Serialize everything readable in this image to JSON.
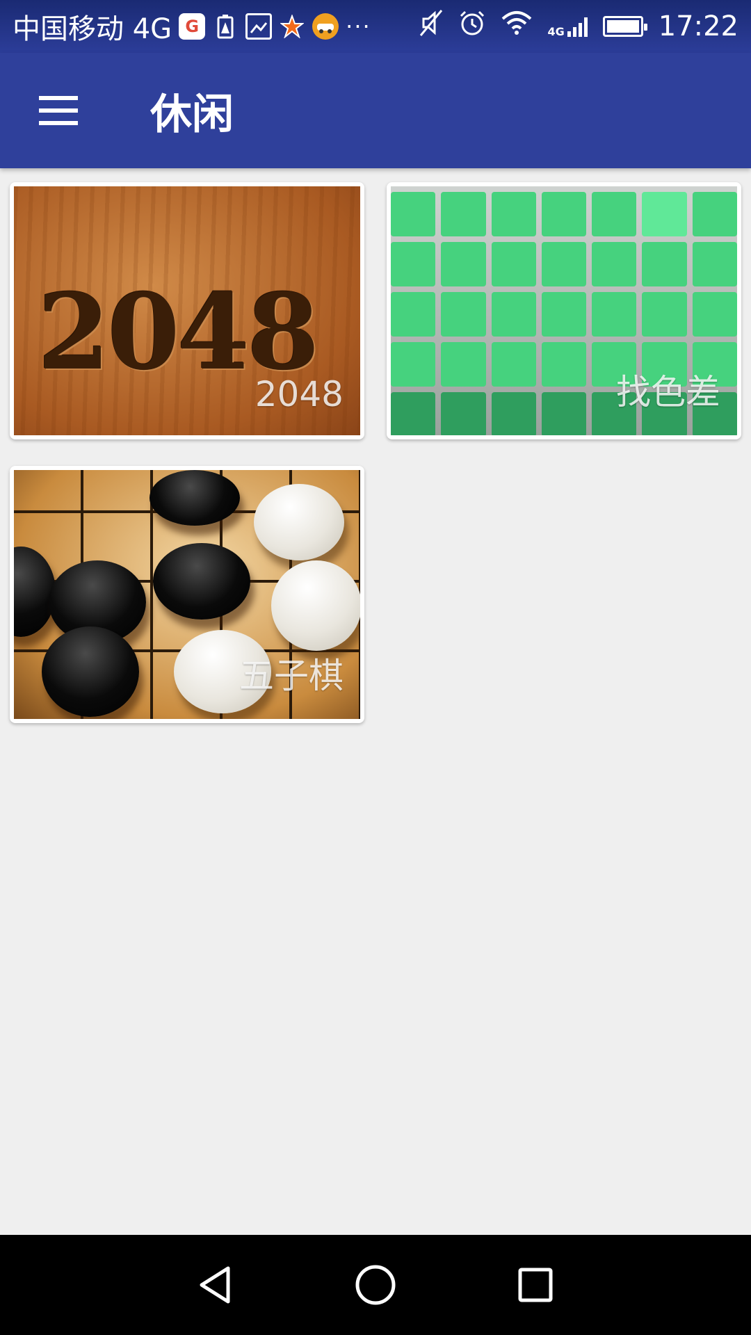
{
  "status_bar": {
    "carrier": "中国移动 4G",
    "network": "4G",
    "time": "17:22",
    "icons": [
      "google-icon",
      "battery-alert-icon",
      "image-icon",
      "star-badge-icon",
      "car-app-icon",
      "more-dots-icon",
      "mute-icon",
      "alarm-icon",
      "wifi-icon",
      "signal-icon",
      "battery-icon"
    ]
  },
  "app_bar": {
    "title": "休闲",
    "menu_icon": "hamburger-icon"
  },
  "games": [
    {
      "label": "2048",
      "art_text": "2048"
    },
    {
      "label": "找色差"
    },
    {
      "label": "五子棋"
    }
  ],
  "nav_bar": {
    "icons": [
      "back-icon",
      "home-icon",
      "recents-icon"
    ]
  },
  "colors": {
    "status_bar": "#1f2f80",
    "app_bar": "#2f409b",
    "background": "#efefef",
    "tile_green": "#46d27e"
  }
}
